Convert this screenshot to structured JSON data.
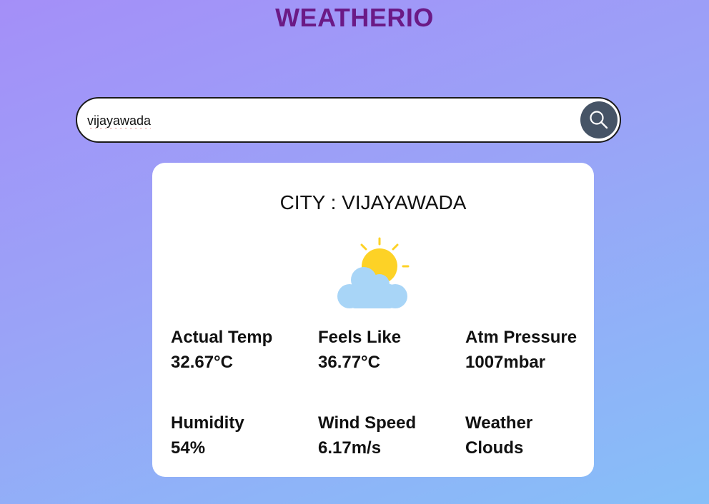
{
  "app": {
    "title": "WEATHERIO"
  },
  "search": {
    "value": "vijayawada",
    "button_icon": "search-icon"
  },
  "card": {
    "city_label": "CITY : VIJAYAWADA",
    "weather_icon": "partly-cloudy-icon",
    "stats": [
      {
        "label": "Actual Temp",
        "value": "32.67°C"
      },
      {
        "label": "Feels Like",
        "value": "36.77°C"
      },
      {
        "label": "Atm Pressure",
        "value": "1007mbar"
      },
      {
        "label": "Humidity",
        "value": "54%"
      },
      {
        "label": "Wind Speed",
        "value": "6.17m/s"
      },
      {
        "label": "Weather",
        "value": "Clouds"
      }
    ]
  },
  "colors": {
    "title": "#6b1a86",
    "search_button": "#465466",
    "sun": "#fdd226",
    "cloud": "#a8d5f7"
  }
}
